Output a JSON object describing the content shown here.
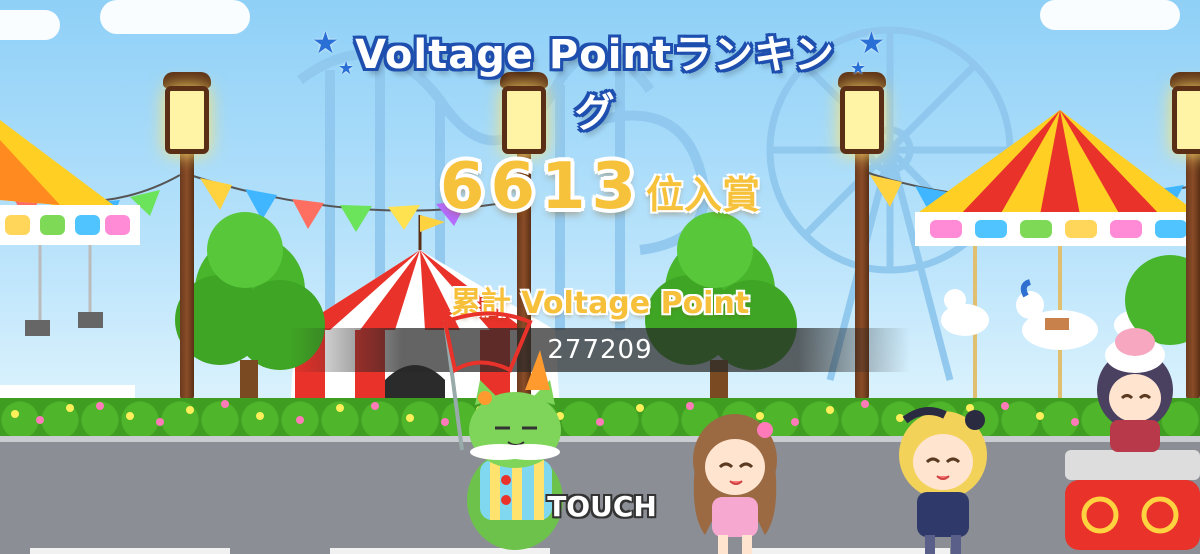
{
  "title": {
    "prefix": "Voltage Point",
    "suffix": "ランキング"
  },
  "result": {
    "rank": "6613",
    "rank_suffix": "位入賞",
    "total_label": "累計 Voltage Point",
    "total_value": "277209"
  },
  "prompt": {
    "touch_label": "TOUCH"
  },
  "colors": {
    "title_outline": "#1f4fae",
    "rank_gold": "#f7c23b",
    "value_bar": "#282828"
  },
  "icons": [
    "star-icon",
    "street-lamp",
    "circus-tent",
    "ferris-wheel",
    "carousel",
    "roller-coaster"
  ],
  "characters": [
    "mascot-cat-clown",
    "idol-brown-hair",
    "idol-blonde",
    "idol-dark-hair-hat"
  ]
}
